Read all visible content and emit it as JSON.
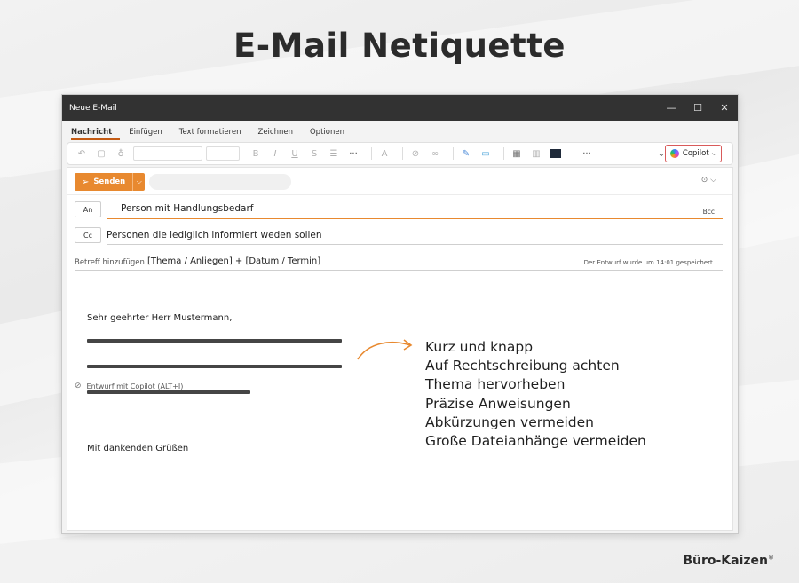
{
  "page": {
    "title": "E-Mail Netiquette",
    "brand": "Büro-Kaizen",
    "brand_mark": "®"
  },
  "window": {
    "title": "Neue E-Mail",
    "controls": {
      "minimize": "—",
      "maximize": "☐",
      "close": "✕"
    }
  },
  "tabs": [
    {
      "label": "Nachricht",
      "active": true
    },
    {
      "label": "Einfügen",
      "active": false
    },
    {
      "label": "Text formatieren",
      "active": false
    },
    {
      "label": "Zeichnen",
      "active": false
    },
    {
      "label": "Optionen",
      "active": false
    }
  ],
  "ribbon": {
    "copilot_label": "Copilot",
    "icons": [
      "undo-icon",
      "paste-icon",
      "format-painter-icon",
      "bold-icon",
      "italic-icon",
      "underline-icon",
      "strikethrough-icon",
      "list-icon",
      "more-icon",
      "styles-icon",
      "attach-icon",
      "link-icon",
      "editor-icon",
      "meeting-icon",
      "table-icon",
      "chart-icon",
      "more-icon"
    ],
    "bold": "B",
    "italic": "I",
    "underline": "U",
    "strike": "S",
    "more": "···",
    "dropdown": "⌄"
  },
  "compose": {
    "send_label": "Senden",
    "to_button": "An",
    "to_value": "Person mit Handlungsbedarf",
    "bcc_label": "Bcc",
    "cc_button": "Cc",
    "cc_value": "Personen die lediglich informiert weden sollen",
    "subject_label": "Betreff hinzufügen",
    "subject_value": "[Thema / Anliegen] + [Datum / Termin]",
    "draft_info": "Der Entwurf wurde um 14:01 gespeichert.",
    "copilot_hint": "Entwurf mit Copilot (ALT+I)",
    "salutation": "Sehr geehrter Herr Mustermann,",
    "closing": "Mit dankenden Grüßen",
    "placeholder_line_fills": [
      1.0,
      1.0,
      0.64
    ]
  },
  "tips": [
    "Kurz und knapp",
    "Auf Rechtschreibung achten",
    "Thema hervorheben",
    "Präzise Anweisungen",
    "Abkürzungen vermeiden",
    "Große Dateianhänge vermeiden"
  ],
  "colors": {
    "accent": "#e8892f",
    "titlebar": "#323232",
    "copilot_border": "#d95a5a"
  }
}
